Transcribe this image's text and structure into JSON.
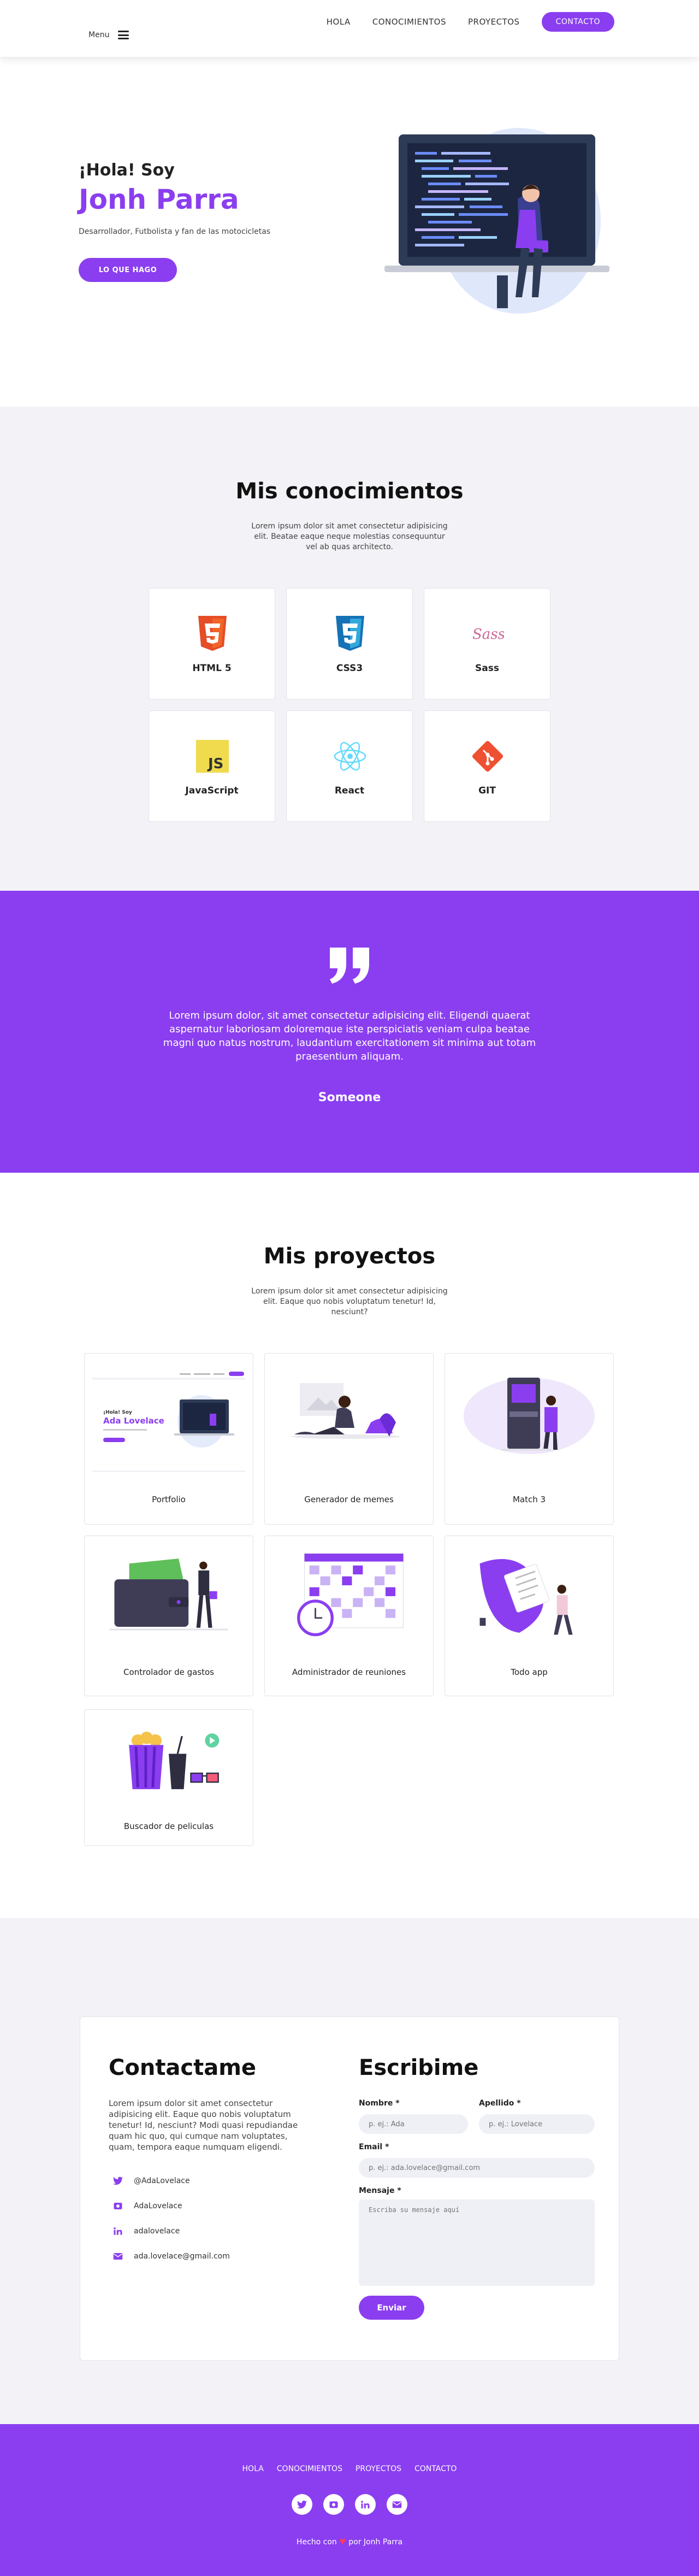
{
  "nav": {
    "links": [
      "HOLA",
      "CONOCIMIENTOS",
      "PROYECTOS"
    ],
    "cta": "CONTACTO",
    "menu_label": "Menu"
  },
  "hero": {
    "greeting": "¡Hola! Soy",
    "name": "Jonh Parra",
    "description": "Desarrollador, Futbolista y fan de las motocicletas",
    "button": "LO QUE HAGO"
  },
  "skills": {
    "title": "Mis conocimientos",
    "subtitle": "Lorem ipsum dolor sit amet consectetur adipisicing elit. Beatae eaque neque molestias consequuntur vel ab quas architecto.",
    "items": [
      {
        "name": "HTML 5",
        "icon": "html5-icon",
        "color": "#e44d26"
      },
      {
        "name": "CSS3",
        "icon": "css3-icon",
        "color": "#1572b6"
      },
      {
        "name": "Sass",
        "icon": "sass-icon",
        "color": "#cd6799"
      },
      {
        "name": "JavaScript",
        "icon": "javascript-icon",
        "color": "#f0db4f"
      },
      {
        "name": "React",
        "icon": "react-icon",
        "color": "#61dafb"
      },
      {
        "name": "GIT",
        "icon": "git-icon",
        "color": "#f05032"
      }
    ]
  },
  "quote": {
    "text": "Lorem ipsum dolor, sit amet consectetur adipisicing elit. Eligendi quaerat aspernatur laboriosam doloremque iste perspiciatis veniam culpa beatae magni quo natus nostrum, laudantium exercitationem sit minima aut totam praesentium aliquam.",
    "author": "Someone"
  },
  "projects": {
    "title": "Mis proyectos",
    "subtitle": "Lorem ipsum dolor sit amet consectetur adipisicing elit. Eaque quo nobis voluptatum tenetur! Id, nesciunt?",
    "items": [
      {
        "name": "Portfolio"
      },
      {
        "name": "Generador de memes"
      },
      {
        "name": "Match 3"
      },
      {
        "name": "Controlador de gastos"
      },
      {
        "name": "Administrador de reuniones"
      },
      {
        "name": "Todo app"
      },
      {
        "name": "Buscador de peliculas"
      }
    ],
    "portfolio_preview": {
      "greet": "¡Hola! Soy",
      "name": "Ada Lovelace"
    }
  },
  "contact": {
    "title": "Contactame",
    "text": "Lorem ipsum dolor sit amet consectetur adipisicing elit. Eaque quo nobis voluptatum tenetur! Id, nesciunt? Modi quasi repudiandae quam hic quo, qui cumque nam voluptates, quam, tempora eaque numquam eligendi.",
    "items": [
      {
        "icon": "twitter-icon",
        "value": "@AdaLovelace"
      },
      {
        "icon": "github-icon",
        "value": "AdaLovelace"
      },
      {
        "icon": "linkedin-icon",
        "value": "adalovelace"
      },
      {
        "icon": "mail-icon",
        "value": "ada.lovelace@gmail.com"
      }
    ]
  },
  "form": {
    "title": "Escribime",
    "nombre_label": "Nombre *",
    "nombre_placeholder": "p. ej.: Ada",
    "apellido_label": "Apellido *",
    "apellido_placeholder": "p. ej.: Lovelace",
    "email_label": "Email *",
    "email_placeholder": "p. ej.: ada.lovelace@gmail.com",
    "mensaje_label": "Mensaje *",
    "mensaje_placeholder": "Escriba su mensaje aquí",
    "submit": "Enviar"
  },
  "footer": {
    "links": [
      "HOLA",
      "CONOCIMIENTOS",
      "PROYECTOS",
      "CONTACTO"
    ],
    "made_prefix": "Hecho con",
    "made_suffix": "por Jonh Parra",
    "socials": [
      "twitter-icon",
      "github-icon",
      "linkedin-icon",
      "mail-icon"
    ]
  },
  "colors": {
    "accent": "#8a3ef0",
    "section_bg": "#f3f3f7"
  }
}
